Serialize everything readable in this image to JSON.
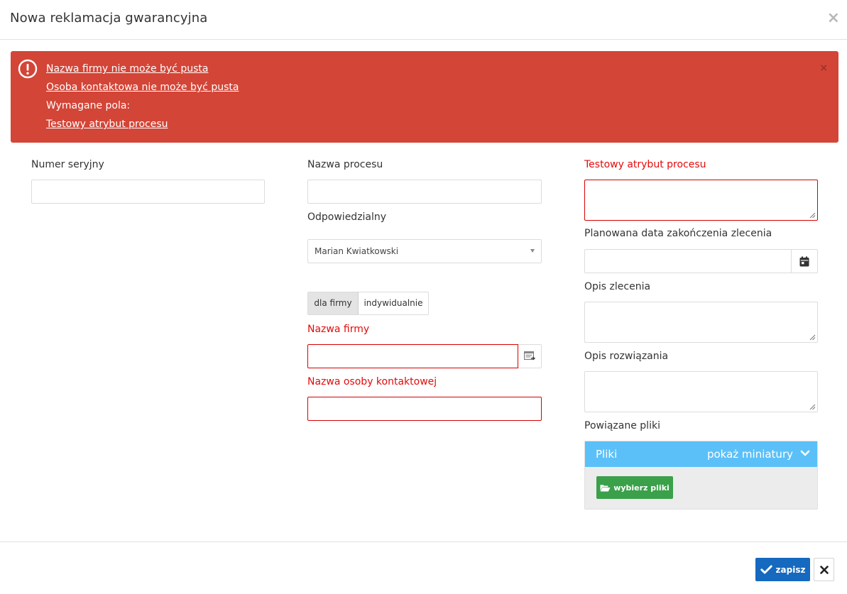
{
  "modal": {
    "title": "Nowa reklamacja gwarancyjna",
    "close_glyph": "×"
  },
  "alert": {
    "icon": "exclamation-circle-icon",
    "lines": [
      "Nazwa firmy nie może być pusta",
      "Osoba kontaktowa nie może być pusta",
      "Wymagane pola:",
      "Testowy atrybut procesu"
    ],
    "close_glyph": "×"
  },
  "form": {
    "serial_number": {
      "label": "Numer seryjny",
      "value": ""
    },
    "process_name": {
      "label": "Nazwa procesu",
      "value": ""
    },
    "responsible": {
      "label": "Odpowiedzialny",
      "value": "Marian Kwiatkowski"
    },
    "client_type": {
      "options": [
        "dla firmy",
        "indywidualnie"
      ],
      "selected": "dla firmy"
    },
    "company_name": {
      "label": "Nazwa firmy",
      "value": ""
    },
    "contact_person": {
      "label": "Nazwa osoby kontaktowej",
      "value": ""
    },
    "test_attribute": {
      "label": "Testowy atrybut procesu",
      "value": ""
    },
    "planned_end_date": {
      "label": "Planowana data zakończenia zlecenia",
      "value": ""
    },
    "order_description": {
      "label": "Opis zlecenia",
      "value": ""
    },
    "solution_description": {
      "label": "Opis rozwiązania",
      "value": ""
    },
    "related_files": {
      "label": "Powiązane pliki",
      "panel_title": "Pliki",
      "toggle_label": "pokaż miniatury",
      "choose_button": "wybierz pliki"
    }
  },
  "footer": {
    "save_label": "zapisz",
    "cancel_glyph": "×"
  },
  "colors": {
    "alert_bg": "#d34537",
    "error_text": "#e20b0b",
    "files_header": "#5bc0f8",
    "choose_button": "#3aa04a",
    "save_button": "#1569bf"
  }
}
